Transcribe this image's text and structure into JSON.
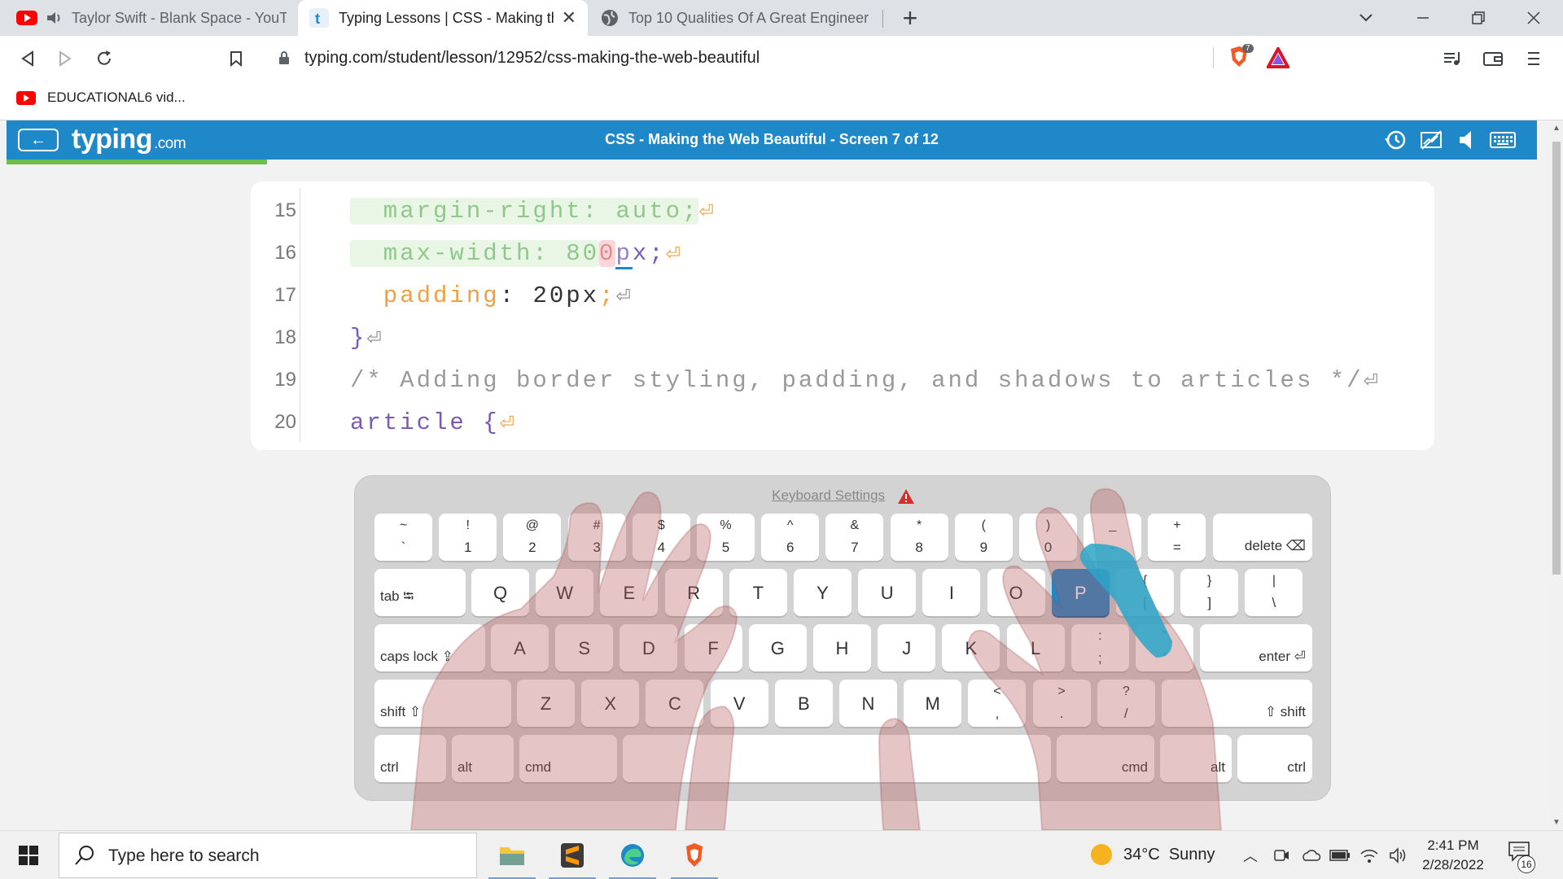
{
  "browser": {
    "tabs": [
      {
        "title": "Taylor Swift - Blank Space - YouTube",
        "favicon": "youtube-icon",
        "audio": true,
        "active": false
      },
      {
        "title": "Typing Lessons | CSS - Making the Web Beautiful",
        "favicon": "typing-favicon",
        "active": true
      },
      {
        "title": "Top 10 Qualities Of A Great Engineer",
        "favicon": "globe-icon",
        "active": false
      }
    ],
    "url": "typing.com/student/lesson/12952/css-making-the-web-beautiful",
    "shield_count": "7",
    "bookmark": "EDUCATIONAL6 vid..."
  },
  "app": {
    "logo_main": "typing",
    "logo_suffix": ".com",
    "lesson_title": "CSS - Making the Web Beautiful - Screen 7 of 12",
    "progress_fraction": 0.17
  },
  "code": {
    "lines": [
      {
        "num": "15",
        "segments": [
          {
            "t": "  margin-right: auto;",
            "c": "done"
          },
          {
            "t": "⏎",
            "c": "ret"
          }
        ]
      },
      {
        "num": "16",
        "segments": [
          {
            "t": "  max-width: 80",
            "c": "done"
          },
          {
            "t": "0",
            "c": "err"
          },
          {
            "t": "p",
            "c": "cursor"
          },
          {
            "t": "x;",
            "c": "sel"
          },
          {
            "t": "⏎",
            "c": "ret"
          }
        ]
      },
      {
        "num": "17",
        "segments": [
          {
            "t": "  padding",
            "c": "kw"
          },
          {
            "t": ": 20px",
            "c": "val"
          },
          {
            "t": ";",
            "c": "kw"
          },
          {
            "t": "⏎",
            "c": "ret gray"
          }
        ]
      },
      {
        "num": "18",
        "segments": [
          {
            "t": "}",
            "c": "sel"
          },
          {
            "t": "⏎",
            "c": "ret gray"
          }
        ]
      },
      {
        "num": "19",
        "segments": [
          {
            "t": "/* Adding border styling, padding, and shadows to articles */",
            "c": "cmt"
          },
          {
            "t": "⏎",
            "c": "ret gray"
          }
        ]
      },
      {
        "num": "20",
        "segments": [
          {
            "t": "article {",
            "c": "sel"
          },
          {
            "t": "⏎",
            "c": "ret"
          }
        ]
      }
    ]
  },
  "keyboard": {
    "settings_label": "Keyboard Settings",
    "highlight_key": "P",
    "rows": [
      [
        [
          "~",
          "`"
        ],
        [
          "!",
          "1"
        ],
        [
          "@",
          "2"
        ],
        [
          "#",
          "3"
        ],
        [
          "$",
          "4"
        ],
        [
          "%",
          "5"
        ],
        [
          "^",
          "6"
        ],
        [
          "&",
          "7"
        ],
        [
          "*",
          "8"
        ],
        [
          "(",
          "9"
        ],
        [
          ")",
          "0"
        ],
        [
          "_",
          "-"
        ],
        [
          "+",
          "="
        ]
      ],
      [
        "Q",
        "W",
        "E",
        "R",
        "T",
        "Y",
        "U",
        "I",
        "O",
        "P"
      ],
      [
        "A",
        "S",
        "D",
        "F",
        "G",
        "H",
        "J",
        "K",
        "L"
      ],
      [
        "Z",
        "X",
        "C",
        "V",
        "B",
        "N",
        "M"
      ]
    ],
    "row1_brackets": [
      [
        "{",
        "["
      ],
      [
        "}",
        "]"
      ],
      [
        "|",
        "\\"
      ]
    ],
    "row2_punct": [
      [
        ":",
        ";"
      ],
      [
        "\"",
        "'"
      ]
    ],
    "row3_punct": [
      [
        "<",
        ","
      ],
      [
        ">",
        "."
      ],
      [
        "?",
        "/"
      ]
    ],
    "labels": {
      "delete": "delete ⌫",
      "tab": "tab ⭾",
      "caps": "caps lock ⇪",
      "enter": "enter ⏎",
      "shift_left": "shift ⇧",
      "shift_right": "⇧ shift",
      "ctrl": "ctrl",
      "alt": "alt",
      "cmd": "cmd"
    }
  },
  "taskbar": {
    "search_placeholder": "Type here to search",
    "weather_temp": "34°C",
    "weather_desc": "Sunny",
    "time": "2:41 PM",
    "date": "2/28/2022",
    "notification_count": "16"
  }
}
